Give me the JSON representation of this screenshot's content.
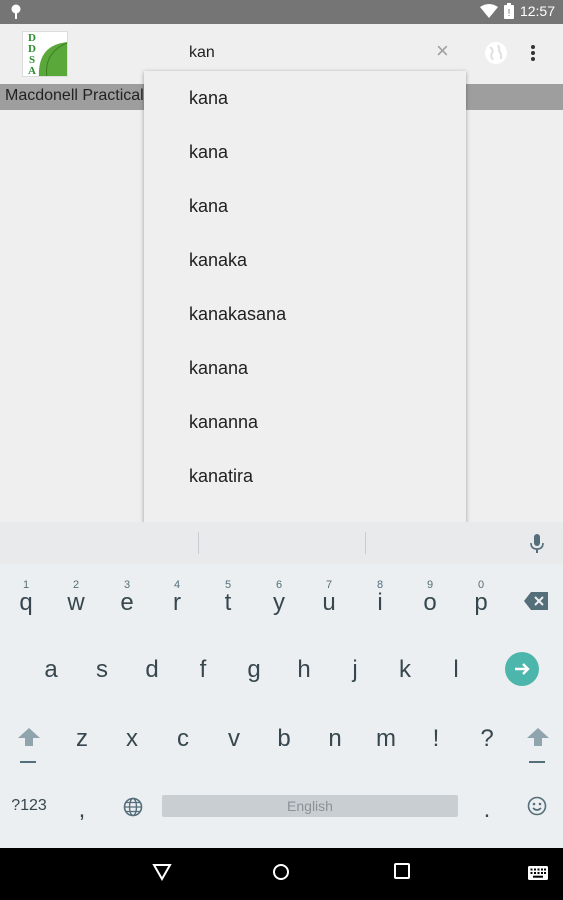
{
  "status_bar": {
    "time": "12:57"
  },
  "app_bar": {
    "logo_letters": "DDSA",
    "search_value": "kan",
    "clear_glyph": "×",
    "globe_icon": "globe-icon",
    "overflow_icon": "more-vert-icon"
  },
  "title_strip": {
    "text": "Macdonell Practical"
  },
  "suggestions": [
    "kana",
    "kana",
    "kana",
    "kanaka",
    "kanakasana",
    "kanana",
    "kananna",
    "kanatira"
  ],
  "keyboard": {
    "row1": [
      "q",
      "w",
      "e",
      "r",
      "t",
      "y",
      "u",
      "i",
      "o",
      "p"
    ],
    "row1_hints": [
      "1",
      "2",
      "3",
      "4",
      "5",
      "6",
      "7",
      "8",
      "9",
      "0"
    ],
    "row2": [
      "a",
      "s",
      "d",
      "f",
      "g",
      "h",
      "j",
      "k",
      "l"
    ],
    "row3": [
      "z",
      "x",
      "c",
      "v",
      "b",
      "n",
      "m",
      "!",
      "?"
    ],
    "symbols_label": "?123",
    "comma": ",",
    "space_label": "English",
    "period": "."
  },
  "colors": {
    "accent": "#4db6ac",
    "status_bar": "#757575",
    "title_strip": "#9e9e9e"
  }
}
